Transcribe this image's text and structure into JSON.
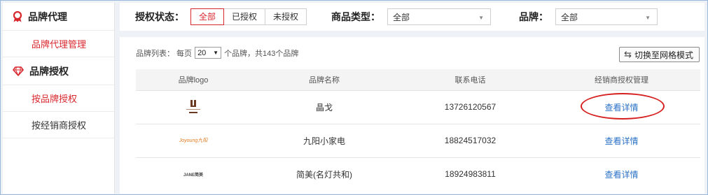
{
  "sidebar": {
    "groups": [
      {
        "title": "品牌代理",
        "icon": "ribbon-award-icon",
        "items": [
          {
            "label": "品牌代理管理",
            "active": true
          }
        ]
      },
      {
        "title": "品牌授权",
        "icon": "diamond-icon",
        "items": [
          {
            "label": "按品牌授权",
            "active": true
          },
          {
            "label": "按经销商授权",
            "active": false
          }
        ]
      }
    ]
  },
  "filter": {
    "auth_status_label": "授权状态：",
    "auth_options": [
      "全部",
      "已授权",
      "未授权"
    ],
    "auth_selected": "全部",
    "category_label": "商品类型：",
    "category_value": "全部",
    "brand_label": "品牌：",
    "brand_value": "全部"
  },
  "list": {
    "prefix": "品牌列表：  每页",
    "per_page": "20",
    "suffix": "个品牌，共143个品牌",
    "switch_label": "切换至网格模式",
    "columns": [
      "品牌logo",
      "品牌名称",
      "联系电话",
      "经销商授权管理"
    ],
    "rows": [
      {
        "logo_text": "JINGE",
        "name": "晶戈",
        "phone": "13726120567",
        "action": "查看详情"
      },
      {
        "logo_text": "Joyoung九阳",
        "name": "九阳小家电",
        "phone": "18824517032",
        "action": "查看详情"
      },
      {
        "logo_text": "JANE简美",
        "name": "简美(名灯共和)",
        "phone": "18924983811",
        "action": "查看详情"
      }
    ]
  },
  "colors": {
    "accent": "#d9272e",
    "link": "#2b72c6",
    "annotation": "#d62020"
  }
}
